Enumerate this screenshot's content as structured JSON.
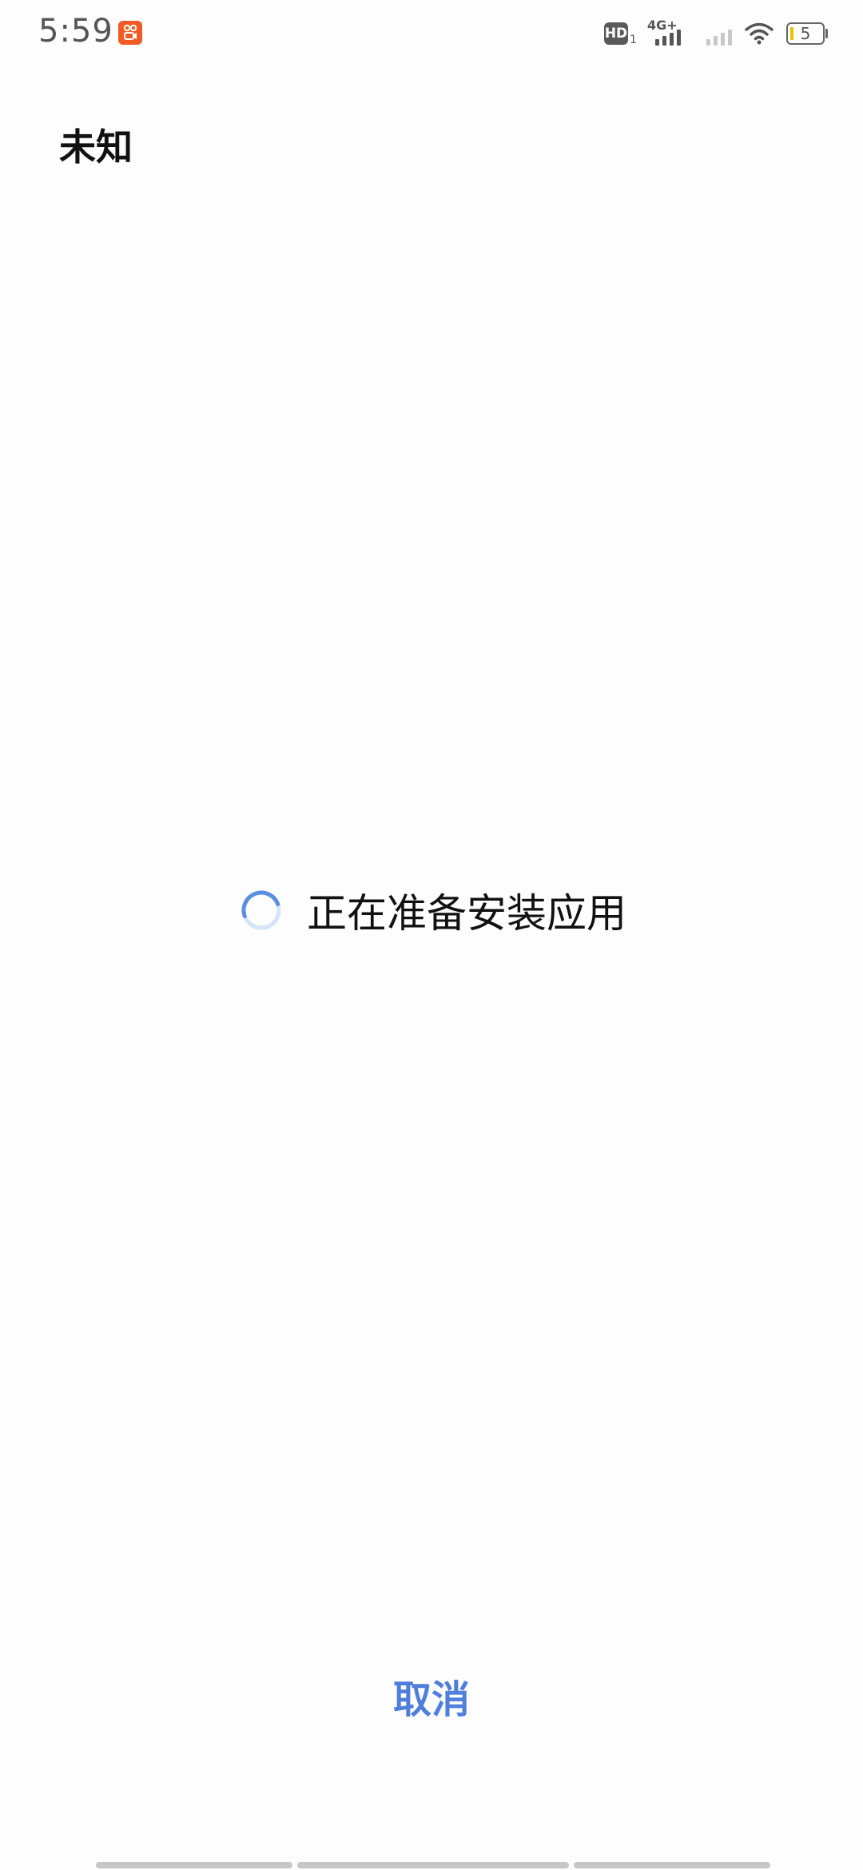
{
  "status_bar": {
    "time": "5:59",
    "notification_icon": "kuaishou-app-icon",
    "hd_label": "HD",
    "hd_sub": "1",
    "network_label": "4G+",
    "battery_level": "5",
    "icons": [
      "hd-icon",
      "signal-icon",
      "signal-icon",
      "wifi-icon",
      "battery-icon"
    ]
  },
  "header": {
    "title": "未知"
  },
  "main": {
    "progress_text": "正在准备安装应用",
    "spinner_icon": "loading-spinner-icon"
  },
  "footer": {
    "cancel_label": "取消"
  },
  "colors": {
    "accent": "#4f7fdc",
    "spinner": "#5b8fe0",
    "spinner_track": "#d6e4f8",
    "background": "#fdfdfd",
    "kuaishou": "#f15a22"
  }
}
